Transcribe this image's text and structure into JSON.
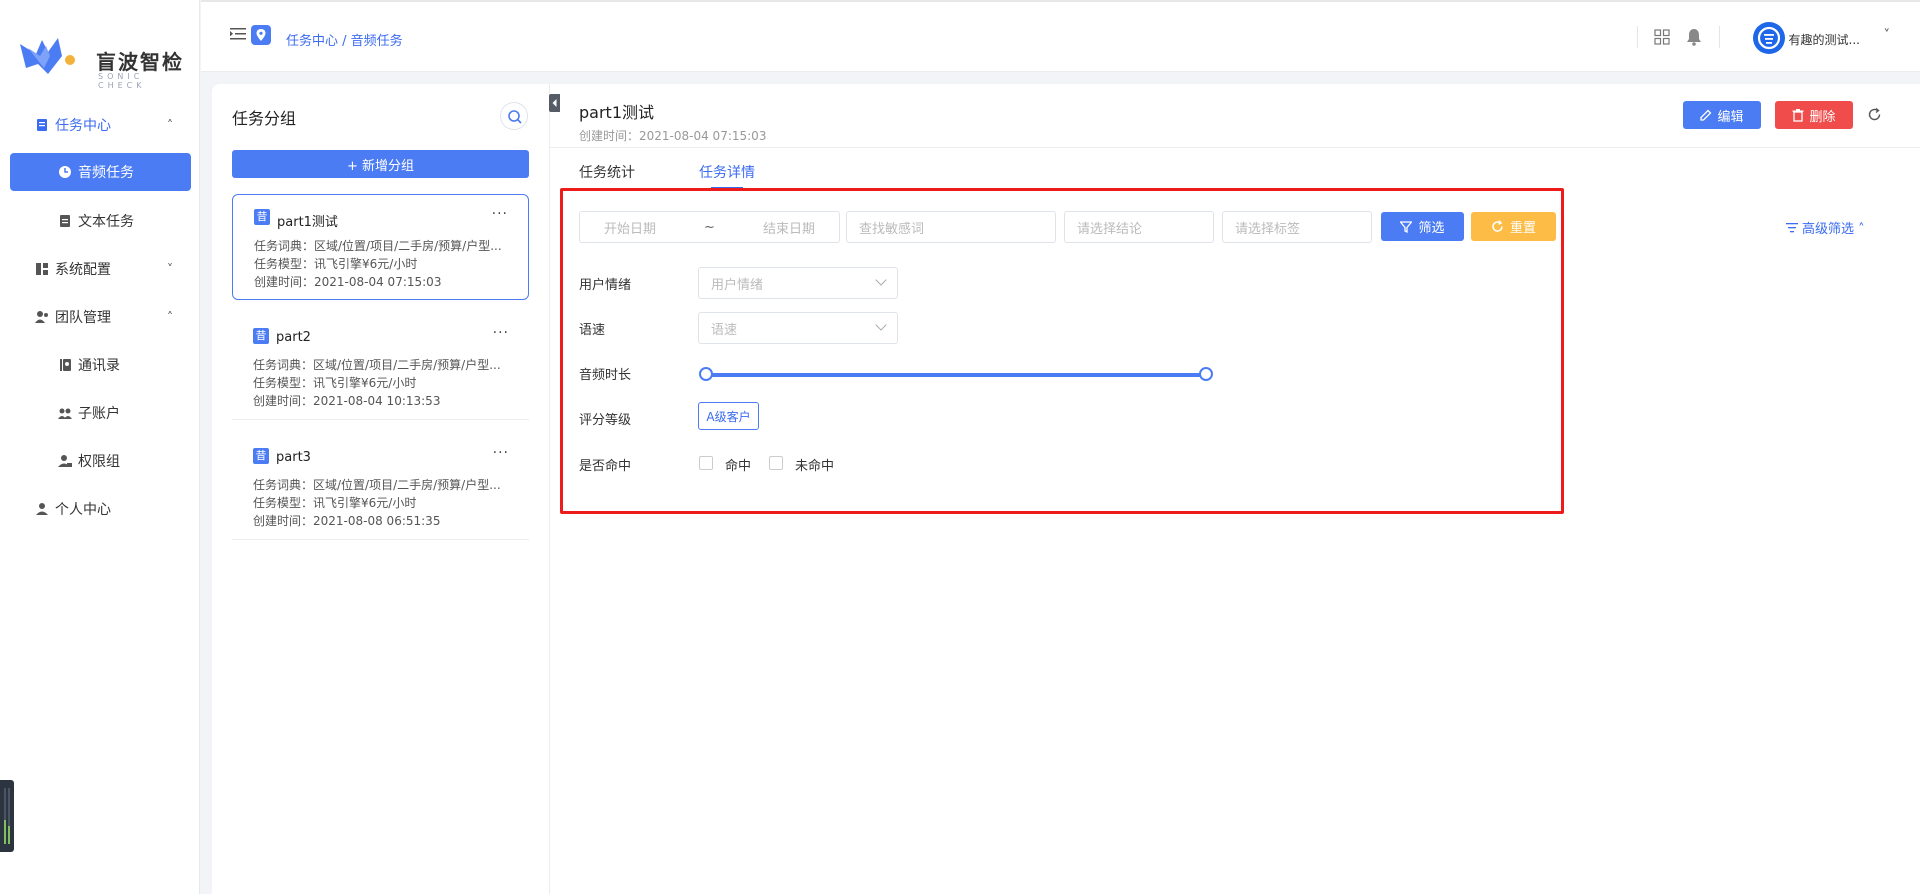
{
  "logo": {
    "name": "盲波智检",
    "sub": "SONIC CHECK"
  },
  "sidebar": {
    "items": [
      {
        "label": "任务中心",
        "chevron": "˄"
      },
      {
        "label": "音频任务"
      },
      {
        "label": "文本任务"
      },
      {
        "label": "系统配置",
        "chevron": "˅"
      },
      {
        "label": "团队管理",
        "chevron": "˄"
      },
      {
        "label": "通讯录"
      },
      {
        "label": "子账户"
      },
      {
        "label": "权限组"
      },
      {
        "label": "个人中心"
      }
    ]
  },
  "header": {
    "breadcrumb": "任务中心 / 音频任务",
    "user_name": "有趣的测试...",
    "user_chevron": "˅"
  },
  "groups": {
    "title": "任务分组",
    "add_label": "+ 新增分组",
    "more": "···",
    "badge_char": "昔",
    "cards": [
      {
        "name": "part1测试",
        "dict": "任务词典：区域/位置/项目/二手房/预算/户型...",
        "model": "任务模型：讯飞引擎¥6元/小时",
        "time": "创建时间：2021-08-04 07:15:03"
      },
      {
        "name": "part2",
        "dict": "任务词典：区域/位置/项目/二手房/预算/户型...",
        "model": "任务模型：讯飞引擎¥6元/小时",
        "time": "创建时间：2021-08-04 10:13:53"
      },
      {
        "name": "part3",
        "dict": "任务词典：区域/位置/项目/二手房/预算/户型...",
        "model": "任务模型：讯飞引擎¥6元/小时",
        "time": "创建时间：2021-08-08 06:51:35"
      }
    ]
  },
  "detail": {
    "title": "part1测试",
    "created": "创建时间：2021-08-04 07:15:03",
    "edit_label": "编辑",
    "delete_label": "删除",
    "tabs": [
      {
        "label": "任务统计"
      },
      {
        "label": "任务详情"
      }
    ]
  },
  "filters": {
    "start_date": "开始日期",
    "date_sep": "~",
    "end_date": "结束日期",
    "keyword_placeholder": "查找敏感词",
    "conclusion_placeholder": "请选择结论",
    "tag_placeholder": "请选择标签",
    "filter_label": "筛选",
    "reset_label": "重置",
    "advanced_label": "高级筛选 ˄",
    "emotion_label": "用户情绪",
    "emotion_placeholder": "用户情绪",
    "speed_label": "语速",
    "speed_placeholder": "语速",
    "duration_label": "音频时长",
    "grade_label": "评分等级",
    "grade_tag": "A级客户",
    "hit_label": "是否命中",
    "hit_option": "命中",
    "miss_option": "未命中"
  },
  "colors": {
    "accent": "#4c7cf3",
    "danger": "#f04c4c",
    "warning": "#fcbc45",
    "highlight": "#ee1b1b"
  }
}
